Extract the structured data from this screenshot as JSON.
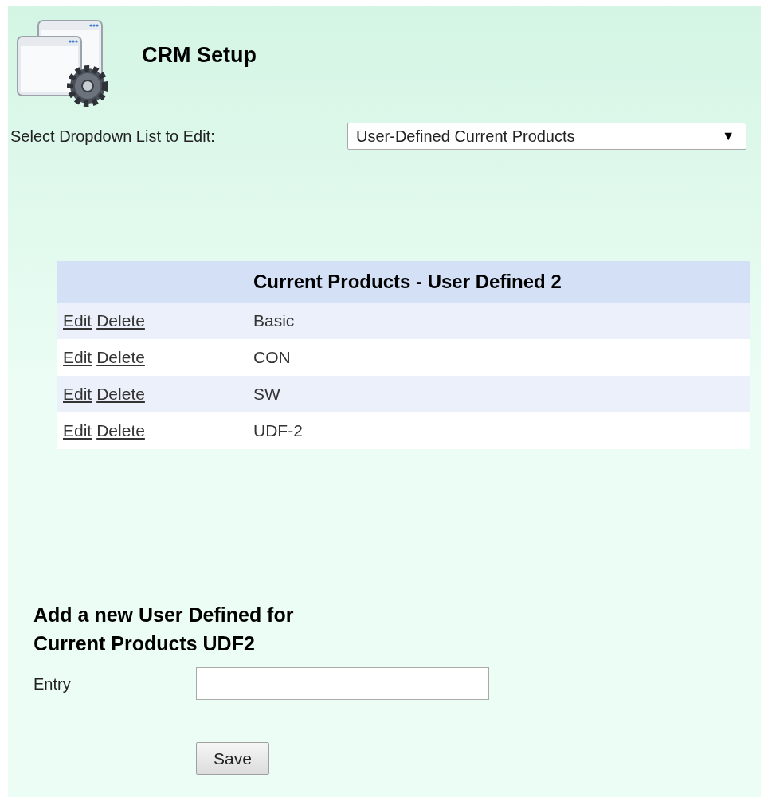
{
  "title": "CRM Setup",
  "dropdown": {
    "label": "Select Dropdown List to Edit:",
    "value": "User-Defined Current Products",
    "arrow": "▼"
  },
  "table": {
    "heading": "Current Products - User Defined 2",
    "rows": [
      {
        "edit": "Edit",
        "delete": "Delete",
        "value": "Basic"
      },
      {
        "edit": "Edit",
        "delete": "Delete",
        "value": "CON"
      },
      {
        "edit": "Edit",
        "delete": "Delete",
        "value": "SW"
      },
      {
        "edit": "Edit",
        "delete": "Delete",
        "value": "UDF-2"
      }
    ]
  },
  "add_form": {
    "heading_lines": [
      "Add a new User Defined for",
      "Current Products UDF2"
    ],
    "entry_label": "Entry",
    "save_button": "Save"
  }
}
